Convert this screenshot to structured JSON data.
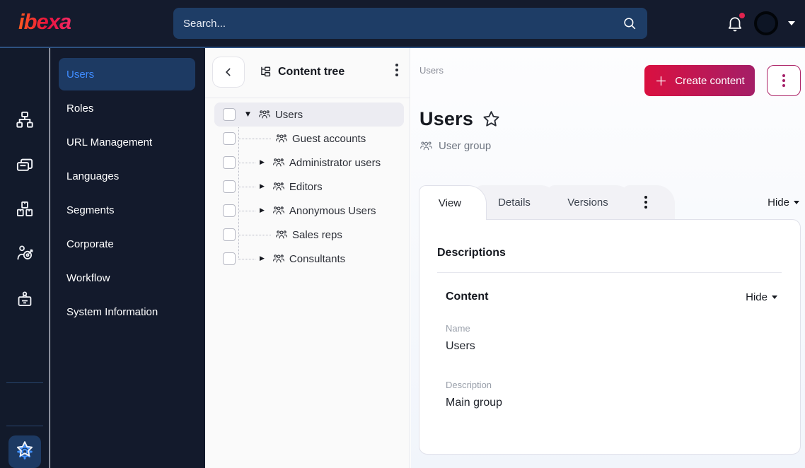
{
  "topbar": {
    "logo_text": "ibexa",
    "search_placeholder": "Search..."
  },
  "rail": {
    "top_icons": [
      "sitemap-icon",
      "pages-icon",
      "products-icon",
      "audience-icon",
      "badge-icon"
    ],
    "settings_icon": "gear-icon",
    "favorites_icon": "star-icon"
  },
  "sidebar": {
    "items": [
      {
        "label": "Users",
        "active": true
      },
      {
        "label": "Roles",
        "active": false
      },
      {
        "label": "URL Management",
        "active": false
      },
      {
        "label": "Languages",
        "active": false
      },
      {
        "label": "Segments",
        "active": false
      },
      {
        "label": "Corporate",
        "active": false
      },
      {
        "label": "Workflow",
        "active": false
      },
      {
        "label": "System Information",
        "active": false
      }
    ]
  },
  "content_tree": {
    "title": "Content tree",
    "items": [
      {
        "label": "Users",
        "level": 0,
        "caret": "down",
        "selected": true,
        "checked": false
      },
      {
        "label": "Guest accounts",
        "level": 1,
        "caret": "none",
        "selected": false,
        "checked": false
      },
      {
        "label": "Administrator users",
        "level": 1,
        "caret": "right",
        "selected": false,
        "checked": false
      },
      {
        "label": "Editors",
        "level": 1,
        "caret": "right",
        "selected": false,
        "checked": false
      },
      {
        "label": "Anonymous Users",
        "level": 1,
        "caret": "right",
        "selected": false,
        "checked": false
      },
      {
        "label": "Sales reps",
        "level": 1,
        "caret": "none",
        "selected": false,
        "checked": false
      },
      {
        "label": "Consultants",
        "level": 1,
        "caret": "right",
        "selected": false,
        "checked": false
      }
    ]
  },
  "main": {
    "breadcrumb": "Users",
    "create_button_label": "Create content",
    "title": "Users",
    "content_type": "User group",
    "tabs": [
      {
        "label": "View",
        "active": true
      },
      {
        "label": "Details",
        "active": false
      },
      {
        "label": "Versions",
        "active": false
      }
    ],
    "hide_label": "Hide",
    "card": {
      "section_title": "Descriptions",
      "group_title": "Content",
      "group_hide_label": "Hide",
      "fields": [
        {
          "label": "Name",
          "value": "Users"
        },
        {
          "label": "Description",
          "value": "Main group"
        }
      ]
    }
  },
  "colors": {
    "topbar_bg": "#141b2d",
    "accent_line": "#2d5180",
    "active_item_bg": "#1d3a63",
    "active_item_text": "#3f8cff",
    "brand_gradient_start": "#ff5a1f",
    "brand_gradient_end": "#f22a63",
    "primary_button_gradient_start": "#da1040",
    "primary_button_gradient_end": "#a41e67",
    "notification_dot": "#e0234e"
  }
}
